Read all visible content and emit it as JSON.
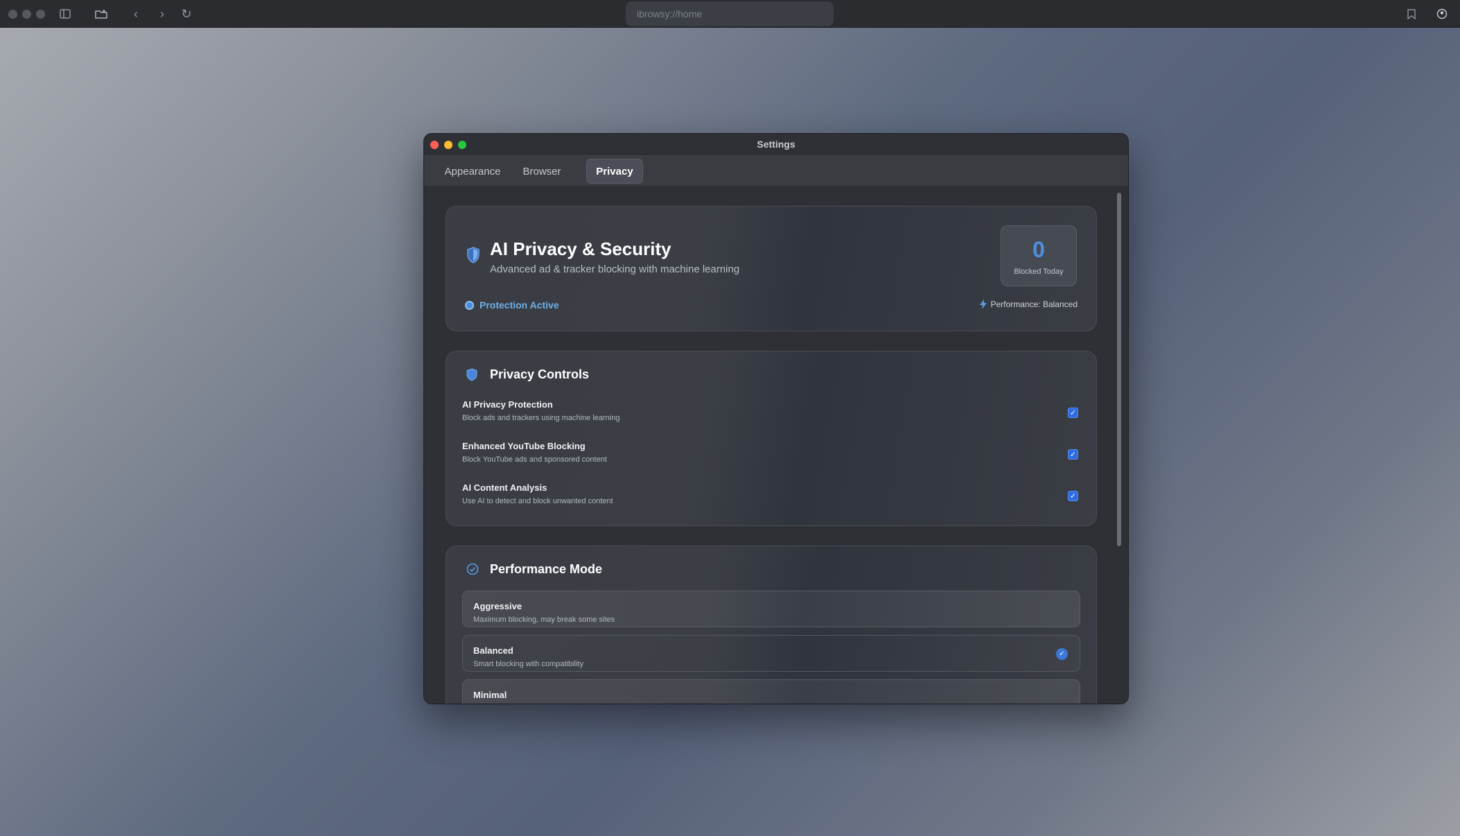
{
  "browser": {
    "url": "ibrowsy://home"
  },
  "window": {
    "title": "Settings",
    "tabs": [
      {
        "label": "Appearance",
        "active": false
      },
      {
        "label": "Browser",
        "active": false
      },
      {
        "label": "Privacy",
        "active": true
      }
    ]
  },
  "hero": {
    "title": "AI Privacy & Security",
    "subtitle": "Advanced ad & tracker blocking with machine learning",
    "stat_value": "0",
    "stat_label": "Blocked Today",
    "status": "Protection Active",
    "performance": "Performance: Balanced"
  },
  "privacy_controls": {
    "title": "Privacy Controls",
    "items": [
      {
        "title": "AI Privacy Protection",
        "description": "Block ads and trackers using machine learning",
        "checked": true
      },
      {
        "title": "Enhanced YouTube Blocking",
        "description": "Block YouTube ads and sponsored content",
        "checked": true
      },
      {
        "title": "AI Content Analysis",
        "description": "Use AI to detect and block unwanted content",
        "checked": true
      }
    ]
  },
  "performance_mode": {
    "title": "Performance Mode",
    "options": [
      {
        "title": "Aggressive",
        "description": "Maximum blocking, may break some sites",
        "selected": false
      },
      {
        "title": "Balanced",
        "description": "Smart blocking with compatibility",
        "selected": true
      },
      {
        "title": "Minimal",
        "description": "",
        "selected": false
      }
    ]
  },
  "colors": {
    "accent": "#4f8fe0",
    "status_text": "#6db0e8",
    "checkbox": "#2f6be0",
    "close": "#ff5f57",
    "minimize": "#febc2e",
    "zoom": "#28c840"
  }
}
